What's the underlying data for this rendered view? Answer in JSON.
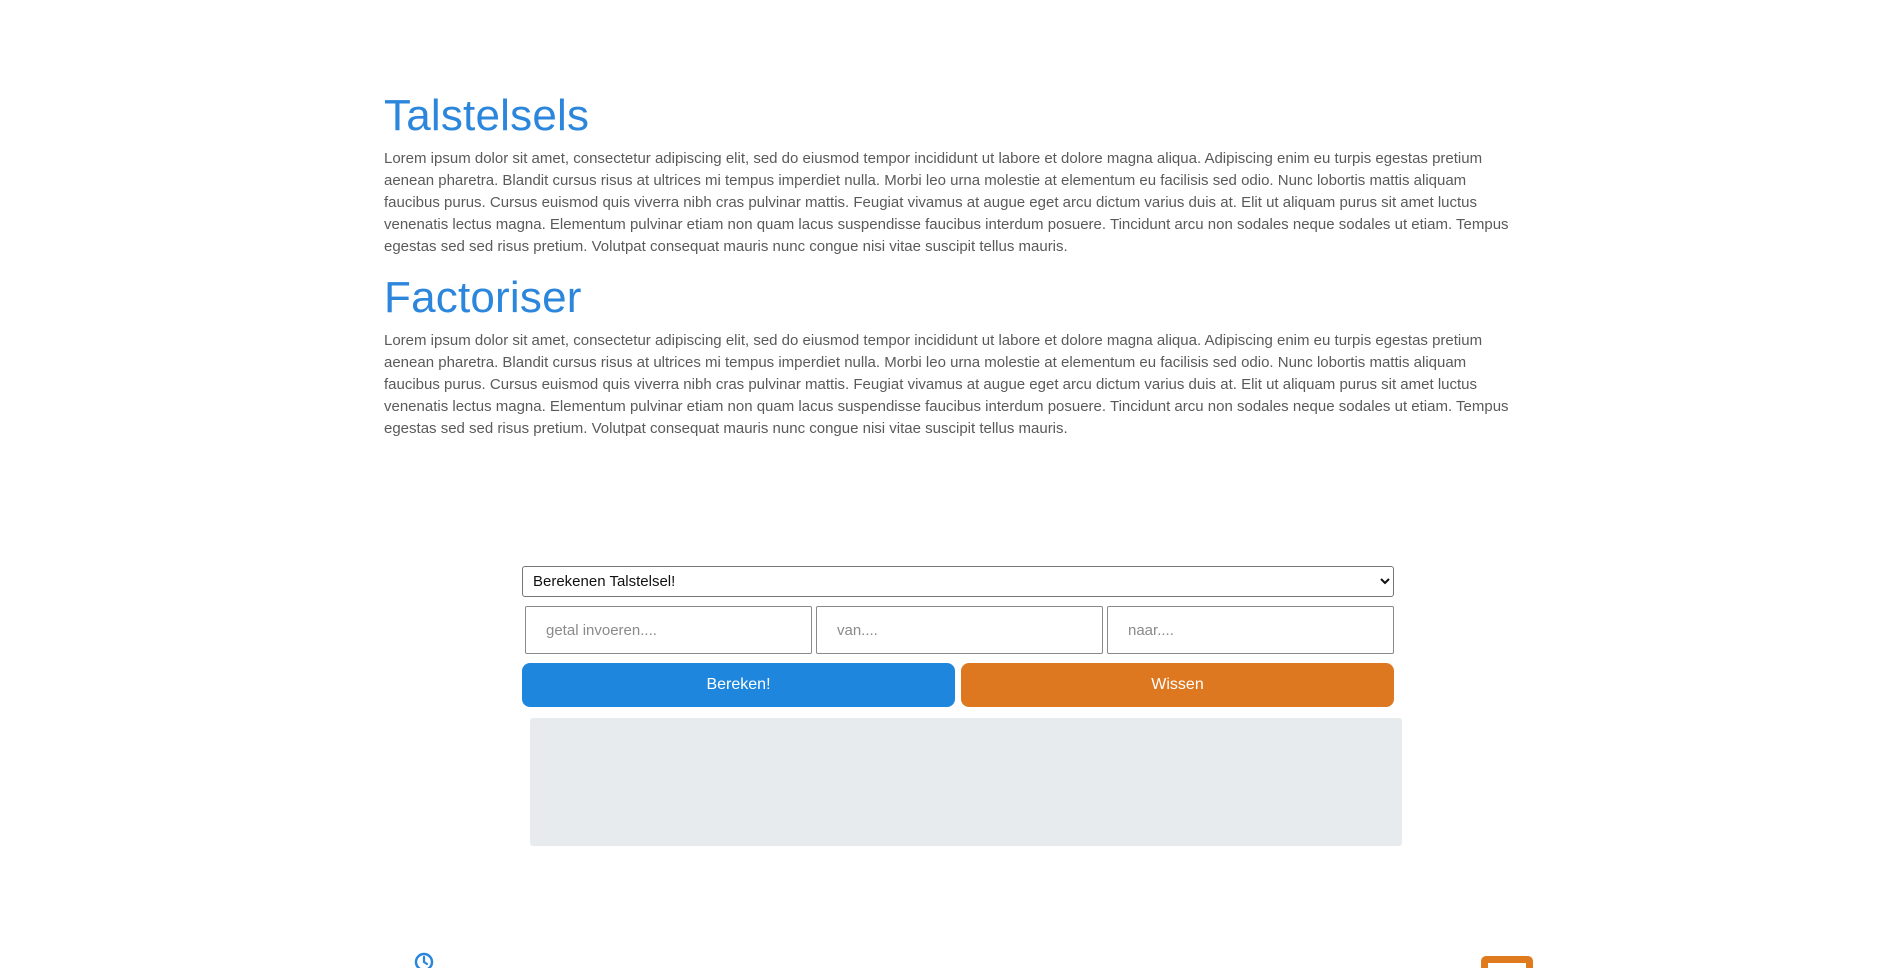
{
  "sections": [
    {
      "title": "Talstelsels",
      "text": "Lorem ipsum dolor sit amet, consectetur adipiscing elit, sed do eiusmod tempor incididunt ut labore et dolore magna aliqua. Adipiscing enim eu turpis egestas pretium aenean pharetra. Blandit cursus risus at ultrices mi tempus imperdiet nulla. Morbi leo urna molestie at elementum eu facilisis sed odio. Nunc lobortis mattis aliquam faucibus purus. Cursus euismod quis viverra nibh cras pulvinar mattis. Feugiat vivamus at augue eget arcu dictum varius duis at. Elit ut aliquam purus sit amet luctus venenatis lectus magna. Elementum pulvinar etiam non quam lacus suspendisse faucibus interdum posuere. Tincidunt arcu non sodales neque sodales ut etiam. Tempus egestas sed sed risus pretium. Volutpat consequat mauris nunc congue nisi vitae suscipit tellus mauris."
    },
    {
      "title": "Factoriser",
      "text": "Lorem ipsum dolor sit amet, consectetur adipiscing elit, sed do eiusmod tempor incididunt ut labore et dolore magna aliqua. Adipiscing enim eu turpis egestas pretium aenean pharetra. Blandit cursus risus at ultrices mi tempus imperdiet nulla. Morbi leo urna molestie at elementum eu facilisis sed odio. Nunc lobortis mattis aliquam faucibus purus. Cursus euismod quis viverra nibh cras pulvinar mattis. Feugiat vivamus at augue eget arcu dictum varius duis at. Elit ut aliquam purus sit amet luctus venenatis lectus magna. Elementum pulvinar etiam non quam lacus suspendisse faucibus interdum posuere. Tincidunt arcu non sodales neque sodales ut etiam. Tempus egestas sed sed risus pretium. Volutpat consequat mauris nunc congue nisi vitae suscipit tellus mauris."
    }
  ],
  "calculator": {
    "mode_selected": "Berekenen Talstelsel!",
    "number_placeholder": "getal invoeren....",
    "from_placeholder": "van....",
    "to_placeholder": "naar....",
    "calculate_label": "Bereken!",
    "clear_label": "Wissen",
    "result_text": ""
  },
  "colors": {
    "accent_blue": "#1f86dd",
    "accent_orange": "#dd7820",
    "heading_blue": "#2b86dc",
    "result_bg": "#e8ebee"
  },
  "icons": {
    "footer_left": "refresh-icon",
    "footer_right": "square-frame-icon"
  }
}
